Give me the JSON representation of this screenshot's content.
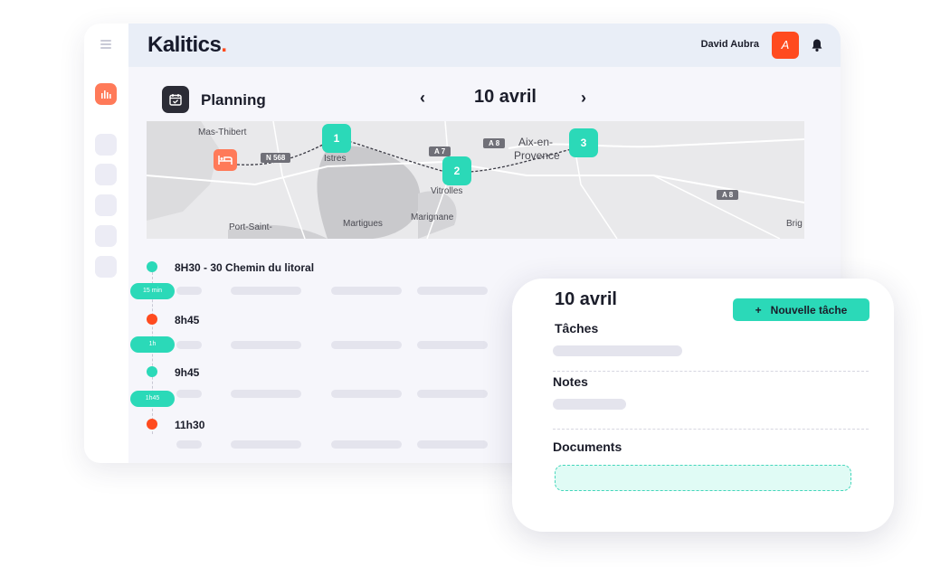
{
  "app": {
    "logo": "Kalitics",
    "logo_dot": ".",
    "user_name": "David Aubra",
    "avatar_initial": "A"
  },
  "colors": {
    "accent": "#2bd9b8",
    "brand": "#ff4b1f",
    "sidebar_active": "#ff7a59",
    "dark": "#1b1d2a"
  },
  "icons": [
    "menu-icon",
    "bar-chart-icon",
    "calendar-check-icon",
    "bell-icon",
    "bed-icon",
    "plus-icon"
  ],
  "planning": {
    "title": "Planning",
    "prev": "‹",
    "next": "›",
    "date": "10 avril"
  },
  "map": {
    "places": [
      "Mas-Thibert",
      "Istres",
      "Aix-en-",
      "Provence",
      "Vitrolles",
      "Port-Saint-",
      "Martigues",
      "Marignane",
      "Brig"
    ],
    "roads": [
      "N 568",
      "A 7",
      "A 8",
      "A 8"
    ],
    "pins": [
      "1",
      "2",
      "3"
    ]
  },
  "timeline": {
    "stops": [
      {
        "label": "8H30 - 30 Chemin du litoral",
        "color": "#2bd9b8"
      },
      {
        "label": "8h45",
        "color": "#ff4b1f"
      },
      {
        "label": "9h45",
        "color": "#2bd9b8"
      },
      {
        "label": "11h30",
        "color": "#ff4b1f"
      }
    ],
    "durations": [
      "15 min",
      "1h",
      "1h45"
    ]
  },
  "detail": {
    "date": "10 avril",
    "new_task_button": "Nouvelle tâche",
    "new_task_icon": "+",
    "sections": {
      "tasks": "Tâches",
      "notes": "Notes",
      "documents": "Documents"
    }
  }
}
